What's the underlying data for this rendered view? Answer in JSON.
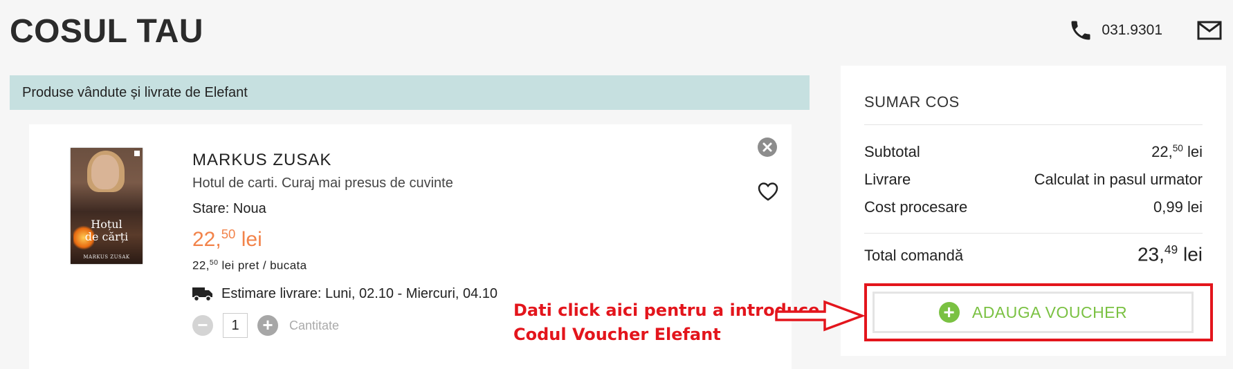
{
  "header": {
    "title": "COSUL TAU",
    "phone": "031.9301"
  },
  "seller_bar": "Produse vândute și livrate de Elefant",
  "product": {
    "cover": {
      "title_line1": "Hoțul",
      "title_line2": "de cărți",
      "author": "MARKUS ZUSAK"
    },
    "author": "MARKUS ZUSAK",
    "title": "Hotul de carti. Curaj mai presus de cuvinte",
    "condition_label": "Stare:",
    "condition_value": "Noua",
    "price_int": "22,",
    "price_dec": "50",
    "price_cur": "lei",
    "unit_int": "22,",
    "unit_dec": "50",
    "unit_suffix": "lei pret / bucata",
    "delivery": "Estimare livrare: Luni, 02.10 - Miercuri, 04.10",
    "quantity": "1",
    "quantity_label": "Cantitate",
    "minus": "−",
    "plus": "+"
  },
  "summary": {
    "title": "SUMAR COS",
    "subtotal_label": "Subtotal",
    "subtotal_int": "22,",
    "subtotal_dec": "50",
    "subtotal_cur": "lei",
    "shipping_label": "Livrare",
    "shipping_value": "Calculat in pasul urmator",
    "processing_label": "Cost procesare",
    "processing_value": "0,99 lei",
    "total_label": "Total comandă",
    "total_int": "23,",
    "total_dec": "49",
    "total_cur": "lei",
    "voucher_label": "ADAUGA VOUCHER",
    "voucher_plus": "+"
  },
  "annotation": {
    "line1": "Dati click aici pentru a introduce",
    "line2": "Codul Voucher Elefant"
  },
  "colors": {
    "accent_orange": "#f2834a",
    "accent_green": "#7ac142",
    "annotation_red": "#e3151c",
    "seller_bar": "#c6e0e0"
  },
  "icons": [
    "phone-icon",
    "mail-icon",
    "remove-icon",
    "heart-icon",
    "truck-icon",
    "plus-icon",
    "arrow-icon"
  ]
}
